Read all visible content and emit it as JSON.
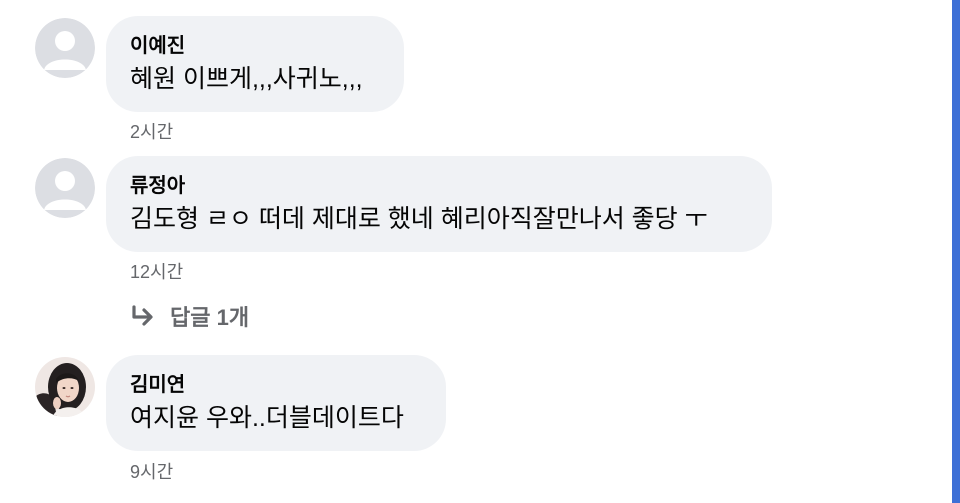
{
  "colors": {
    "bubble": "#f0f2f5",
    "meta_text": "#65676b",
    "body_text": "#050505",
    "accent_edge": "#3d6fd6"
  },
  "comments": [
    {
      "author": "이예진",
      "text": "혜원 이쁘게,,,사귀노,,,",
      "time": "2시간",
      "avatar": "default-avatar-icon"
    },
    {
      "author": "류정아",
      "text": "김도형 ㄹㅇ 떠데 제대로 했네 혜리아직잘만나서 좋당 ㅜ",
      "time": "12시간",
      "avatar": "default-avatar-icon"
    },
    {
      "author": "김미연",
      "text": "여지윤 우와..더블데이트다",
      "time": "9시간",
      "avatar": "profile-photo"
    }
  ],
  "replies": {
    "label": "답글 1개",
    "icon": "reply-arrow-icon"
  }
}
